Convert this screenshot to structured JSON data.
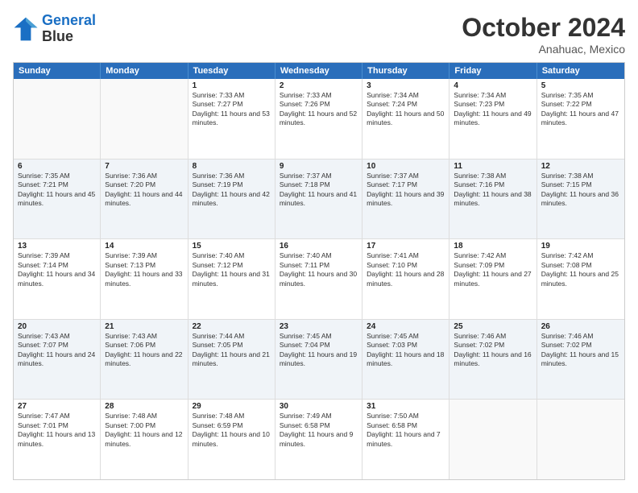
{
  "logo": {
    "line1": "General",
    "line2": "Blue"
  },
  "title": "October 2024",
  "subtitle": "Anahuac, Mexico",
  "days": [
    "Sunday",
    "Monday",
    "Tuesday",
    "Wednesday",
    "Thursday",
    "Friday",
    "Saturday"
  ],
  "weeks": [
    [
      {
        "day": "",
        "info": ""
      },
      {
        "day": "",
        "info": ""
      },
      {
        "day": "1",
        "info": "Sunrise: 7:33 AM\nSunset: 7:27 PM\nDaylight: 11 hours and 53 minutes."
      },
      {
        "day": "2",
        "info": "Sunrise: 7:33 AM\nSunset: 7:26 PM\nDaylight: 11 hours and 52 minutes."
      },
      {
        "day": "3",
        "info": "Sunrise: 7:34 AM\nSunset: 7:24 PM\nDaylight: 11 hours and 50 minutes."
      },
      {
        "day": "4",
        "info": "Sunrise: 7:34 AM\nSunset: 7:23 PM\nDaylight: 11 hours and 49 minutes."
      },
      {
        "day": "5",
        "info": "Sunrise: 7:35 AM\nSunset: 7:22 PM\nDaylight: 11 hours and 47 minutes."
      }
    ],
    [
      {
        "day": "6",
        "info": "Sunrise: 7:35 AM\nSunset: 7:21 PM\nDaylight: 11 hours and 45 minutes."
      },
      {
        "day": "7",
        "info": "Sunrise: 7:36 AM\nSunset: 7:20 PM\nDaylight: 11 hours and 44 minutes."
      },
      {
        "day": "8",
        "info": "Sunrise: 7:36 AM\nSunset: 7:19 PM\nDaylight: 11 hours and 42 minutes."
      },
      {
        "day": "9",
        "info": "Sunrise: 7:37 AM\nSunset: 7:18 PM\nDaylight: 11 hours and 41 minutes."
      },
      {
        "day": "10",
        "info": "Sunrise: 7:37 AM\nSunset: 7:17 PM\nDaylight: 11 hours and 39 minutes."
      },
      {
        "day": "11",
        "info": "Sunrise: 7:38 AM\nSunset: 7:16 PM\nDaylight: 11 hours and 38 minutes."
      },
      {
        "day": "12",
        "info": "Sunrise: 7:38 AM\nSunset: 7:15 PM\nDaylight: 11 hours and 36 minutes."
      }
    ],
    [
      {
        "day": "13",
        "info": "Sunrise: 7:39 AM\nSunset: 7:14 PM\nDaylight: 11 hours and 34 minutes."
      },
      {
        "day": "14",
        "info": "Sunrise: 7:39 AM\nSunset: 7:13 PM\nDaylight: 11 hours and 33 minutes."
      },
      {
        "day": "15",
        "info": "Sunrise: 7:40 AM\nSunset: 7:12 PM\nDaylight: 11 hours and 31 minutes."
      },
      {
        "day": "16",
        "info": "Sunrise: 7:40 AM\nSunset: 7:11 PM\nDaylight: 11 hours and 30 minutes."
      },
      {
        "day": "17",
        "info": "Sunrise: 7:41 AM\nSunset: 7:10 PM\nDaylight: 11 hours and 28 minutes."
      },
      {
        "day": "18",
        "info": "Sunrise: 7:42 AM\nSunset: 7:09 PM\nDaylight: 11 hours and 27 minutes."
      },
      {
        "day": "19",
        "info": "Sunrise: 7:42 AM\nSunset: 7:08 PM\nDaylight: 11 hours and 25 minutes."
      }
    ],
    [
      {
        "day": "20",
        "info": "Sunrise: 7:43 AM\nSunset: 7:07 PM\nDaylight: 11 hours and 24 minutes."
      },
      {
        "day": "21",
        "info": "Sunrise: 7:43 AM\nSunset: 7:06 PM\nDaylight: 11 hours and 22 minutes."
      },
      {
        "day": "22",
        "info": "Sunrise: 7:44 AM\nSunset: 7:05 PM\nDaylight: 11 hours and 21 minutes."
      },
      {
        "day": "23",
        "info": "Sunrise: 7:45 AM\nSunset: 7:04 PM\nDaylight: 11 hours and 19 minutes."
      },
      {
        "day": "24",
        "info": "Sunrise: 7:45 AM\nSunset: 7:03 PM\nDaylight: 11 hours and 18 minutes."
      },
      {
        "day": "25",
        "info": "Sunrise: 7:46 AM\nSunset: 7:02 PM\nDaylight: 11 hours and 16 minutes."
      },
      {
        "day": "26",
        "info": "Sunrise: 7:46 AM\nSunset: 7:02 PM\nDaylight: 11 hours and 15 minutes."
      }
    ],
    [
      {
        "day": "27",
        "info": "Sunrise: 7:47 AM\nSunset: 7:01 PM\nDaylight: 11 hours and 13 minutes."
      },
      {
        "day": "28",
        "info": "Sunrise: 7:48 AM\nSunset: 7:00 PM\nDaylight: 11 hours and 12 minutes."
      },
      {
        "day": "29",
        "info": "Sunrise: 7:48 AM\nSunset: 6:59 PM\nDaylight: 11 hours and 10 minutes."
      },
      {
        "day": "30",
        "info": "Sunrise: 7:49 AM\nSunset: 6:58 PM\nDaylight: 11 hours and 9 minutes."
      },
      {
        "day": "31",
        "info": "Sunrise: 7:50 AM\nSunset: 6:58 PM\nDaylight: 11 hours and 7 minutes."
      },
      {
        "day": "",
        "info": ""
      },
      {
        "day": "",
        "info": ""
      }
    ]
  ]
}
